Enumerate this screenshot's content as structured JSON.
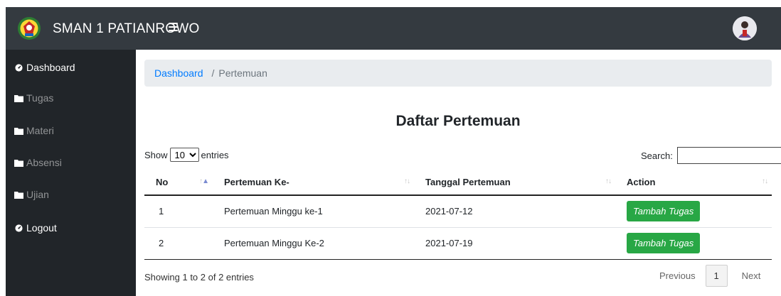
{
  "navbar": {
    "brand": "SMAN 1 PATIANROWO",
    "logo_icon": "school-emblem-icon",
    "menu_icon": "hamburger-menu-icon",
    "avatar_icon": "user-avatar-icon"
  },
  "sidebar": {
    "items": [
      {
        "label": "Dashboard",
        "icon": "tachometer-icon",
        "active": true
      },
      {
        "label": "Tugas",
        "icon": "folder-icon",
        "active": false
      },
      {
        "label": "Materi",
        "icon": "folder-icon",
        "active": false
      },
      {
        "label": "Absensi",
        "icon": "folder-icon",
        "active": false
      },
      {
        "label": "Ujian",
        "icon": "folder-icon",
        "active": false
      },
      {
        "label": "Logout",
        "icon": "tachometer-icon",
        "active": true
      }
    ]
  },
  "breadcrumb": {
    "home": "Dashboard",
    "separator": "/",
    "current": "Pertemuan"
  },
  "page": {
    "title": "Daftar Pertemuan"
  },
  "table_controls": {
    "show_label": "Show",
    "entries_label": "entries",
    "page_length": "10",
    "search_label": "Search:",
    "search_value": ""
  },
  "table": {
    "headers": [
      "No",
      "Pertemuan Ke-",
      "Tanggal Pertemuan",
      "Action"
    ],
    "rows": [
      {
        "no": "1",
        "pertemuan": "Pertemuan Minggu ke-1",
        "tanggal": "2021-07-12",
        "action": "Tambah Tugas"
      },
      {
        "no": "2",
        "pertemuan": "Pertemuan Minggu Ke-2",
        "tanggal": "2021-07-19",
        "action": "Tambah Tugas"
      }
    ]
  },
  "footer": {
    "info": "Showing 1 to 2 of 2 entries",
    "previous": "Previous",
    "current_page": "1",
    "next": "Next"
  },
  "colors": {
    "navbar": "#343a40",
    "sidebar": "#212529",
    "link": "#007bff",
    "action_button": "#28a745"
  }
}
